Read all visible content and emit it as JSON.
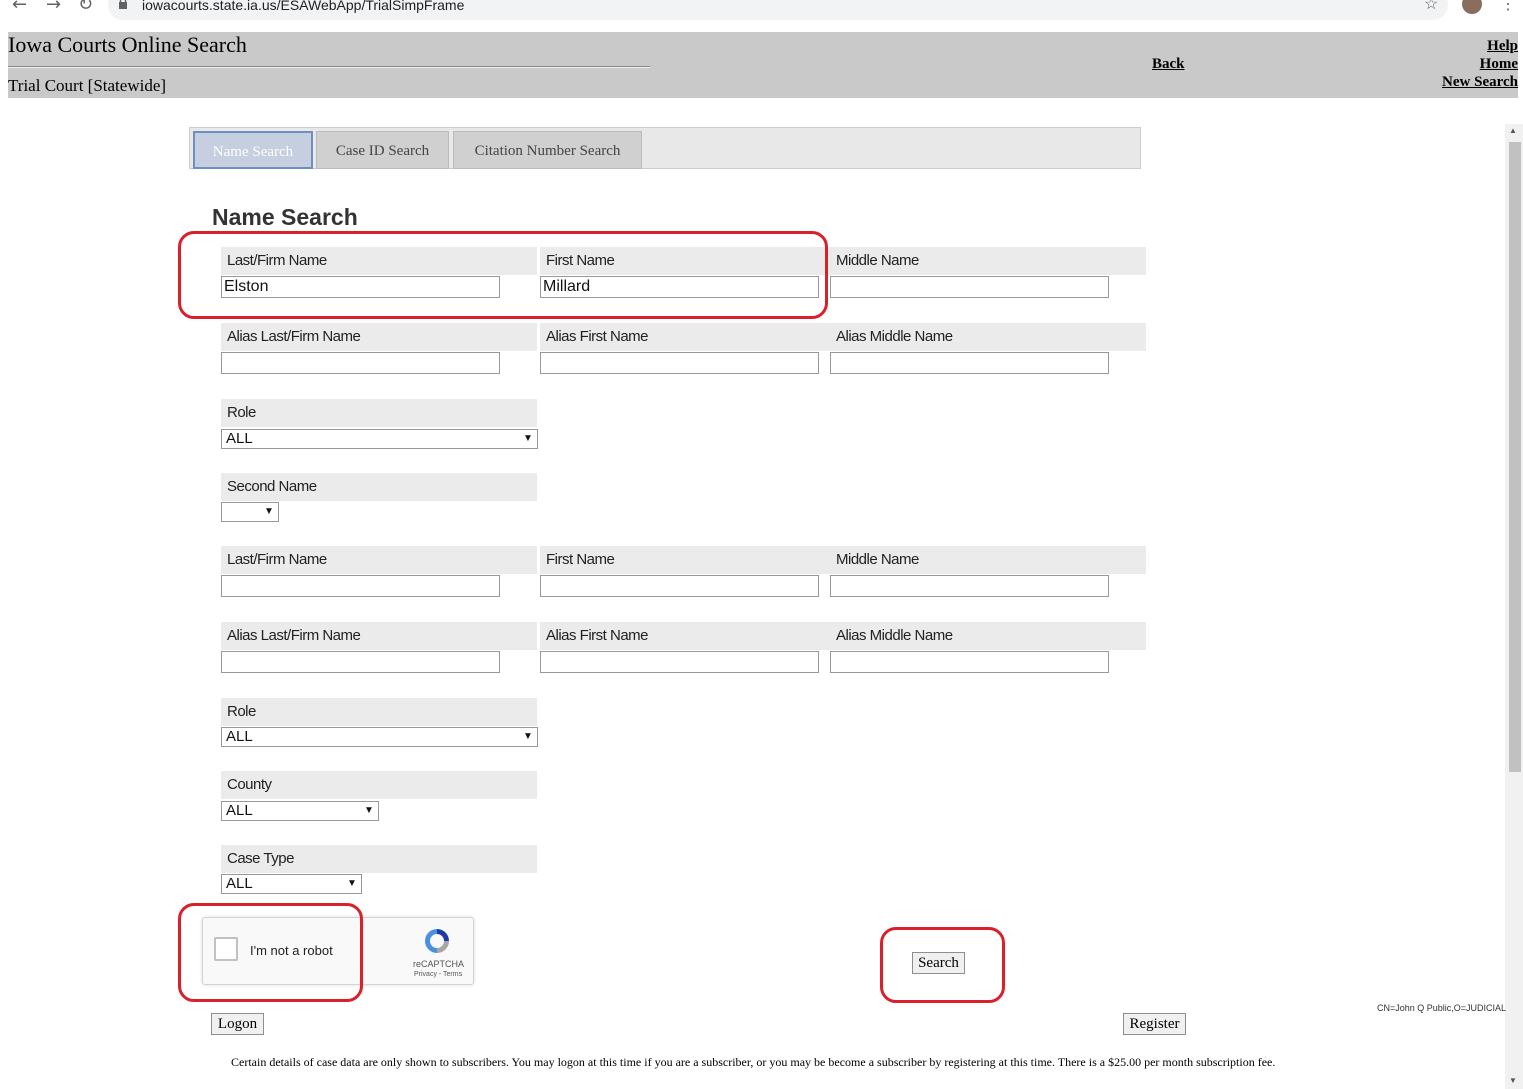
{
  "browser": {
    "url": "iowacourts.state.ia.us/ESAWebApp/TrialSimpFrame",
    "back_glyph": "←",
    "forward_glyph": "→",
    "reload_glyph": "↻",
    "star_glyph": "☆",
    "menu_glyph": "⋮"
  },
  "header": {
    "title": "Iowa Courts Online Search",
    "subtitle": "Trial Court [Statewide]",
    "links": {
      "back": "Back",
      "help": "Help",
      "home": "Home",
      "new_search": "New Search"
    }
  },
  "tabs": [
    {
      "label": "Name Search",
      "active": true
    },
    {
      "label": "Case ID Search",
      "active": false
    },
    {
      "label": "Citation Number Search",
      "active": false
    }
  ],
  "form": {
    "title": "Name Search",
    "primary": {
      "last_label": "Last/Firm Name",
      "last_value": "Elston",
      "first_label": "First Name",
      "first_value": "Millard",
      "middle_label": "Middle Name",
      "middle_value": "",
      "alias_last_label": "Alias Last/Firm Name",
      "alias_first_label": "Alias First Name",
      "alias_middle_label": "Alias Middle Name",
      "role_label": "Role",
      "role_value": "ALL"
    },
    "second_name_label": "Second Name",
    "second_name_value": "",
    "secondary": {
      "last_label": "Last/Firm Name",
      "first_label": "First Name",
      "middle_label": "Middle Name",
      "alias_last_label": "Alias Last/Firm Name",
      "alias_first_label": "Alias First Name",
      "alias_middle_label": "Alias Middle Name",
      "role_label": "Role",
      "role_value": "ALL"
    },
    "county_label": "County",
    "county_value": "ALL",
    "case_type_label": "Case Type",
    "case_type_value": "ALL",
    "select_caret": "▼"
  },
  "captcha": {
    "label": "I'm not a robot",
    "brand": "reCAPTCHA",
    "terms": "Privacy - Terms"
  },
  "buttons": {
    "search": "Search",
    "logon": "Logon",
    "register": "Register"
  },
  "cert_info": "CN=John Q Public,O=JUDICIAL",
  "footnote": "Certain details of case data are only shown to subscribers. You may logon at this time if you are a subscriber, or you may be become a subscriber by registering at this time. There is a $25.00 per month subscription fee.",
  "colors": {
    "annotation_red": "#d9202b",
    "header_gray": "#c9c9c9",
    "active_tab": "#c5cfe0"
  }
}
